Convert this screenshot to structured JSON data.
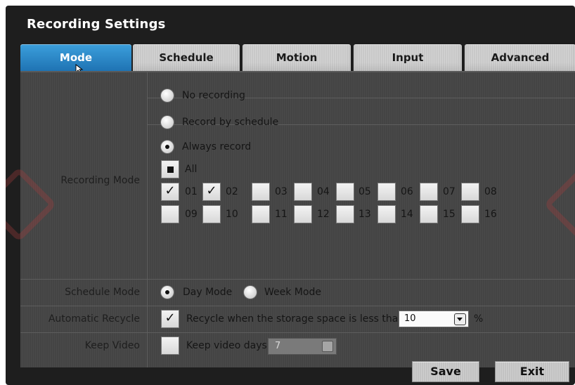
{
  "window": {
    "title": "Recording Settings"
  },
  "tabs": [
    {
      "label": "Mode",
      "active": true
    },
    {
      "label": "Schedule",
      "active": false
    },
    {
      "label": "Motion",
      "active": false
    },
    {
      "label": "Input",
      "active": false
    },
    {
      "label": "Advanced",
      "active": false
    }
  ],
  "recording_mode": {
    "label": "Recording Mode",
    "options": [
      {
        "label": "No recording",
        "selected": false
      },
      {
        "label": "Record by schedule",
        "selected": false
      },
      {
        "label": "Always record",
        "selected": true
      }
    ],
    "all_label": "All",
    "all_checked": "partial",
    "channels": [
      {
        "label": "01",
        "checked": true
      },
      {
        "label": "02",
        "checked": true
      },
      {
        "label": "03",
        "checked": false
      },
      {
        "label": "04",
        "checked": false
      },
      {
        "label": "05",
        "checked": false
      },
      {
        "label": "06",
        "checked": false
      },
      {
        "label": "07",
        "checked": false
      },
      {
        "label": "08",
        "checked": false
      },
      {
        "label": "09",
        "checked": false
      },
      {
        "label": "10",
        "checked": false
      },
      {
        "label": "11",
        "checked": false
      },
      {
        "label": "12",
        "checked": false
      },
      {
        "label": "13",
        "checked": false
      },
      {
        "label": "14",
        "checked": false
      },
      {
        "label": "15",
        "checked": false
      },
      {
        "label": "16",
        "checked": false
      }
    ]
  },
  "schedule_mode": {
    "label": "Schedule Mode",
    "options": [
      {
        "label": "Day Mode",
        "selected": true
      },
      {
        "label": "Week Mode",
        "selected": false
      }
    ]
  },
  "automatic_recycle": {
    "label": "Automatic Recycle",
    "checked": true,
    "text": "Recycle when the storage space is less than",
    "value": "10",
    "unit": "%"
  },
  "keep_video": {
    "label": "Keep Video",
    "checked": false,
    "text": "Keep video days",
    "value": "7"
  },
  "buttons": {
    "save": "Save",
    "exit": "Exit"
  },
  "colors": {
    "active_tab": "#2a8ccc",
    "panel": "#464646",
    "window": "#1e1e1e"
  }
}
